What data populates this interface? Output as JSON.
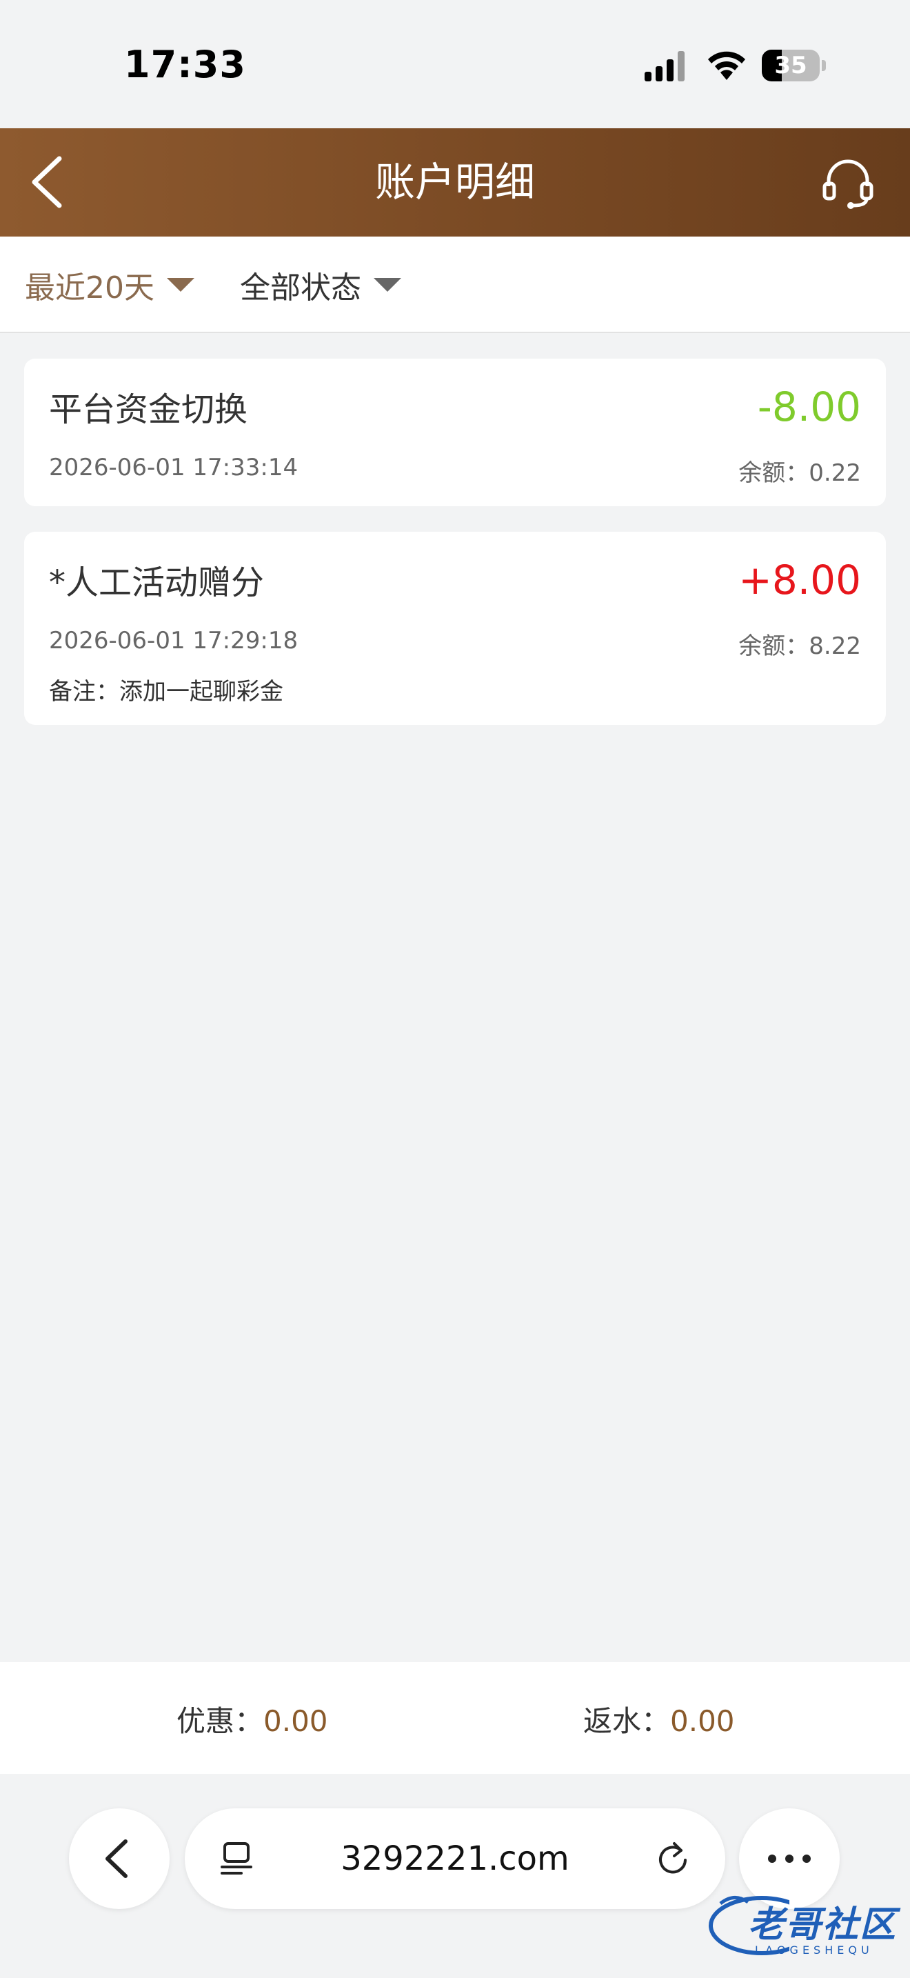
{
  "status_bar": {
    "time": "17:33",
    "battery_level": "35",
    "battery_fraction": 0.35,
    "icons": [
      "signal-icon",
      "wifi-icon",
      "battery-icon"
    ]
  },
  "header": {
    "title": "账户明细",
    "back_icon": "chevron-left-icon",
    "support_icon": "headset-icon"
  },
  "filters": {
    "days_label": "最近20天",
    "status_label": "全部状态"
  },
  "transactions": [
    {
      "title": "平台资金切换",
      "amount": "-8.00",
      "time": "2026-06-01 17:33:14",
      "balance": "余额：0.22"
    },
    {
      "title": "*人工活动赠分",
      "amount": "+8.00",
      "time": "2026-06-01 17:29:18",
      "balance": "余额：8.22",
      "note": "备注：添加一起聊彩金"
    }
  ],
  "summary": {
    "promo_label": "优惠：",
    "promo_value": "0.00",
    "rebate_label": "返水：",
    "rebate_value": "0.00"
  },
  "browser": {
    "url": "3292221.com",
    "icons": [
      "back-icon",
      "tabs-icon",
      "reload-icon",
      "more-icon"
    ]
  },
  "watermark": {
    "main": "老哥社区",
    "sub": "LAOGESHEQU"
  },
  "colors": {
    "header_brown": "#7a4a24",
    "negative_amount": "#7fcb2c",
    "positive_amount": "#e7161c",
    "accent_brown": "#8a5a2b"
  }
}
